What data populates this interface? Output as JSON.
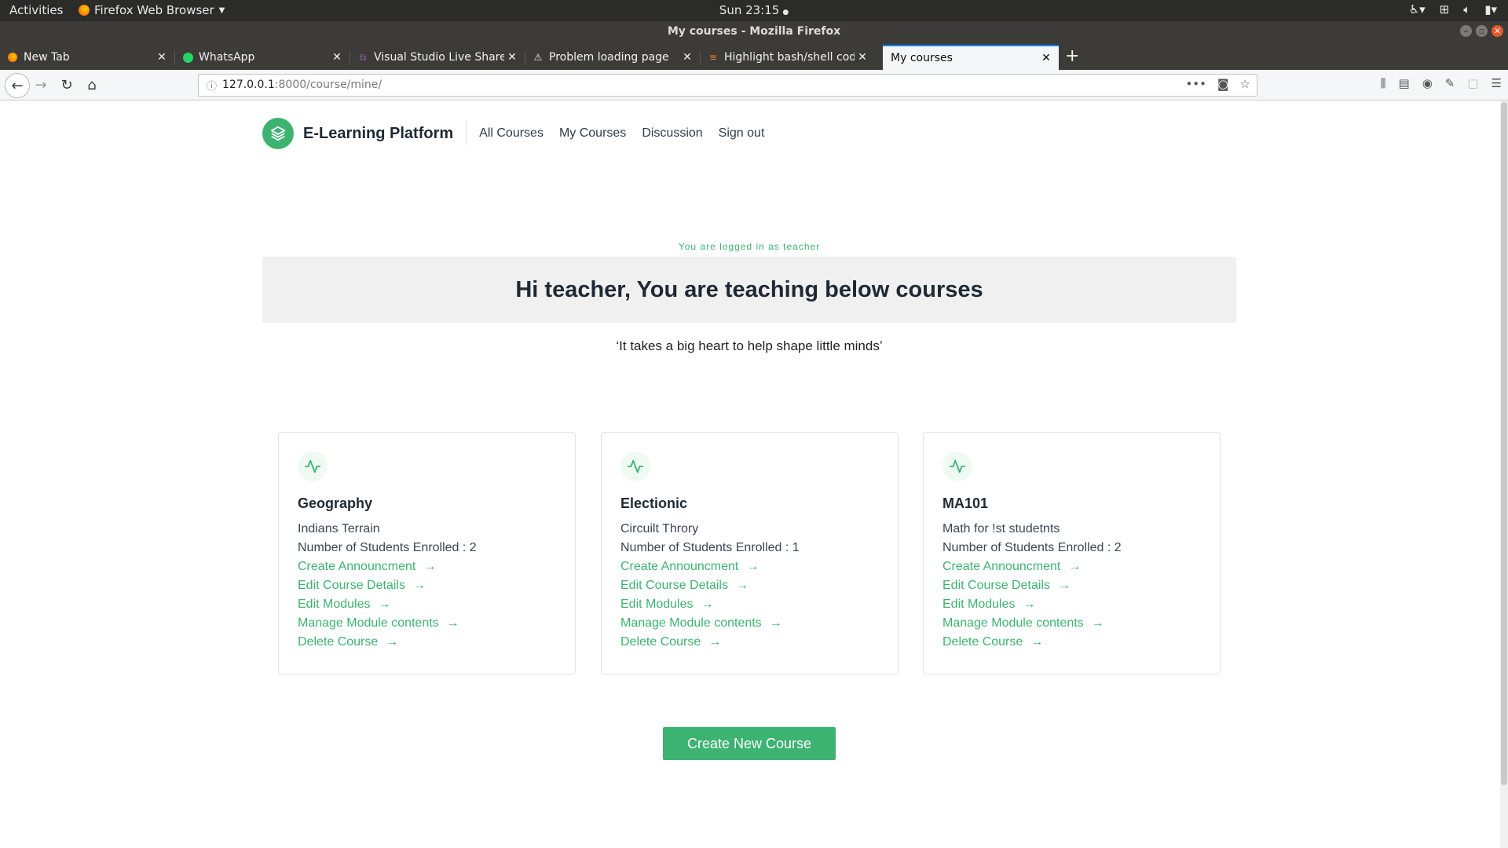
{
  "system_bar": {
    "activities": "Activities",
    "app_menu": "Firefox Web Browser",
    "clock": "Sun 23:15"
  },
  "window": {
    "title": "My courses - Mozilla Firefox"
  },
  "tabs": [
    {
      "label": "New Tab",
      "icon": "firefox-icon"
    },
    {
      "label": "WhatsApp",
      "icon": "whatsapp-icon"
    },
    {
      "label": "Visual Studio Live Share",
      "icon": "vs-icon"
    },
    {
      "label": "Problem loading page",
      "icon": "warning-icon"
    },
    {
      "label": "Highlight bash/shell code",
      "icon": "stackoverflow-icon"
    },
    {
      "label": "My courses",
      "icon": "",
      "active": true
    }
  ],
  "address_bar": {
    "host": "127.0.0.1",
    "rest": ":8000/course/mine/"
  },
  "site": {
    "brand": "E-Learning Platform",
    "nav": [
      "All Courses",
      "My Courses",
      "Discussion",
      "Sign out"
    ],
    "logged_in_text": "You are logged in as teacher",
    "hero_title": "Hi teacher, You are teaching below courses",
    "quote": "‘It takes a big heart to help shape little minds’",
    "create_button": "Create New Course"
  },
  "courses": [
    {
      "title": "Geography",
      "description": "Indians Terrain",
      "enrolled": "Number of Students Enrolled : 2",
      "links": [
        "Create Announcment",
        "Edit Course Details",
        "Edit Modules",
        "Manage Module contents",
        "Delete Course"
      ]
    },
    {
      "title": "Electionic",
      "description": "Circuilt Throry",
      "enrolled": "Number of Students Enrolled : 1",
      "links": [
        "Create Announcment",
        "Edit Course Details",
        "Edit Modules",
        "Manage Module contents",
        "Delete Course"
      ]
    },
    {
      "title": "MA101",
      "description": "Math for !st studetnts",
      "enrolled": "Number of Students Enrolled : 2",
      "links": [
        "Create Announcment",
        "Edit Course Details",
        "Edit Modules",
        "Manage Module contents",
        "Delete Course"
      ]
    }
  ],
  "colors": {
    "accent": "#3cb371",
    "firefox_blue": "#0a84ff"
  }
}
